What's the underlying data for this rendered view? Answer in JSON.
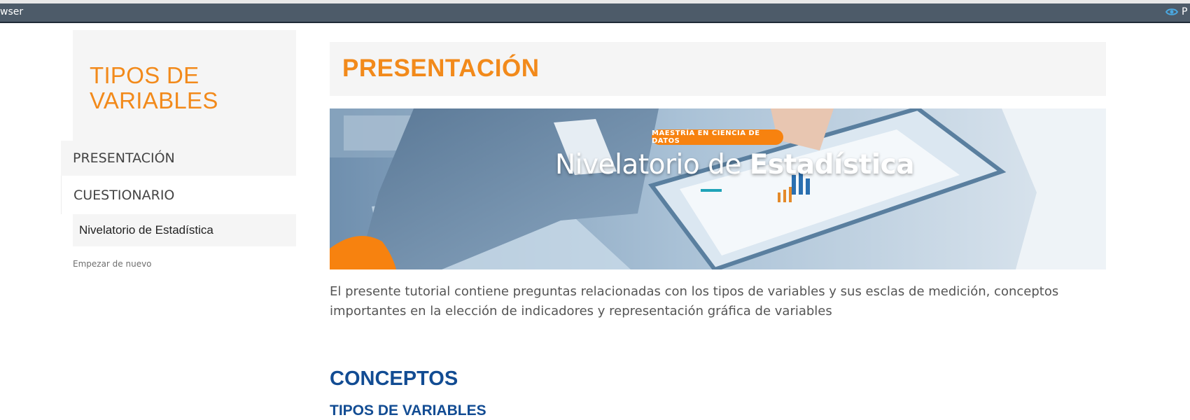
{
  "topbar": {
    "left_text": "wser",
    "right_text": "P",
    "right_icon": "eye-icon"
  },
  "sidebar": {
    "title": "TIPOS DE VARIABLES",
    "items": [
      {
        "label": "PRESENTACIÓN"
      },
      {
        "label": "CUESTIONARIO"
      }
    ],
    "sub_item": "Nivelatorio de Estadística",
    "restart_label": "Empezar de nuevo"
  },
  "main": {
    "title": "PRESENTACIÓN",
    "banner": {
      "badge": "MAESTRÍA EN CIENCIA DE DATOS",
      "title_regular": "Nivelatorio de ",
      "title_bold": "Estadística"
    },
    "intro": "El presente tutorial contiene preguntas relacionadas con los tipos de variables y sus esclas de medición, conceptos importantes en la elección de indicadores y representación gráfica de variables",
    "section_heading": "CONCEPTOS",
    "subsection_heading": "TIPOS DE VARIABLES"
  },
  "colors": {
    "accent_orange": "#f28a1b",
    "heading_blue": "#124c93",
    "topbar": "#4d5b69"
  }
}
